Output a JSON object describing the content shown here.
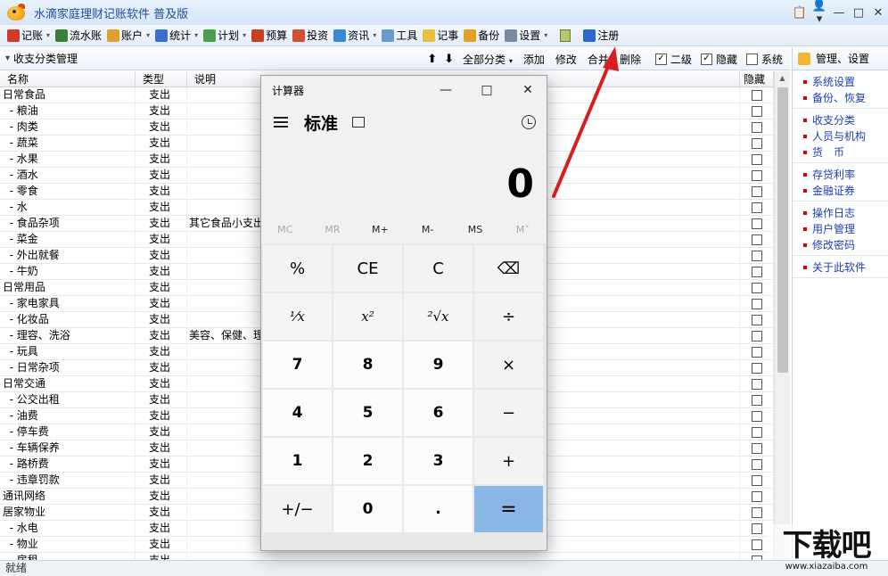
{
  "window": {
    "title": "水滴家庭理财记账软件  普及版",
    "controls": [
      "📋",
      "👤▾",
      "—",
      "□",
      "✕"
    ]
  },
  "menubar": {
    "items": [
      {
        "label": "记账",
        "has_arrow": true,
        "color": "#d23a2a"
      },
      {
        "label": "流水账",
        "has_arrow": false,
        "color": "#3c7f3c"
      },
      {
        "label": "账户",
        "has_arrow": true,
        "color": "#e0a030"
      },
      {
        "label": "统计",
        "has_arrow": true,
        "color": "#3a6fd0"
      },
      {
        "label": "计划",
        "has_arrow": true,
        "color": "#4aa04a"
      },
      {
        "label": "预算",
        "has_arrow": false,
        "color": "#c94020"
      },
      {
        "label": "投资",
        "has_arrow": false,
        "color": "#d05030"
      },
      {
        "label": "资讯",
        "has_arrow": true,
        "color": "#3a8ad0"
      },
      {
        "label": "工具",
        "has_arrow": false,
        "color": "#6a9ad0"
      },
      {
        "label": "记事",
        "has_arrow": false,
        "color": "#e8c040"
      },
      {
        "label": "备份",
        "has_arrow": false,
        "color": "#e0a020"
      },
      {
        "label": "设置",
        "has_arrow": true,
        "color": "#7a8aa0"
      },
      {
        "label": "注册",
        "has_arrow": false,
        "color": "#2a6ad0"
      }
    ]
  },
  "subbar": {
    "title": "收支分类管理",
    "filter": "全部分类",
    "actions": [
      "添加",
      "修改",
      "合并",
      "删除"
    ],
    "checks": [
      {
        "label": "二级",
        "checked": true
      },
      {
        "label": "隐藏",
        "checked": true
      },
      {
        "label": "系统",
        "checked": false
      }
    ]
  },
  "table": {
    "headers": {
      "name": "名称",
      "type": "类型",
      "desc": "说明",
      "hide": "隐藏"
    },
    "rows": [
      {
        "name": "日常食品",
        "type": "支出",
        "desc": ""
      },
      {
        "name": "  - 粮油",
        "type": "支出",
        "desc": ""
      },
      {
        "name": "  - 肉类",
        "type": "支出",
        "desc": ""
      },
      {
        "name": "  - 蔬菜",
        "type": "支出",
        "desc": ""
      },
      {
        "name": "  - 水果",
        "type": "支出",
        "desc": ""
      },
      {
        "name": "  - 酒水",
        "type": "支出",
        "desc": ""
      },
      {
        "name": "  - 零食",
        "type": "支出",
        "desc": ""
      },
      {
        "name": "  - 水",
        "type": "支出",
        "desc": ""
      },
      {
        "name": "  - 食品杂项",
        "type": "支出",
        "desc": "其它食品小支出"
      },
      {
        "name": "  - 菜金",
        "type": "支出",
        "desc": ""
      },
      {
        "name": "  - 外出就餐",
        "type": "支出",
        "desc": ""
      },
      {
        "name": "  - 牛奶",
        "type": "支出",
        "desc": ""
      },
      {
        "name": "日常用品",
        "type": "支出",
        "desc": ""
      },
      {
        "name": "  - 家电家具",
        "type": "支出",
        "desc": ""
      },
      {
        "name": "  - 化妆品",
        "type": "支出",
        "desc": ""
      },
      {
        "name": "  - 理容、洗浴",
        "type": "支出",
        "desc": "美容、保健、理"
      },
      {
        "name": "  - 玩具",
        "type": "支出",
        "desc": ""
      },
      {
        "name": "  - 日常杂项",
        "type": "支出",
        "desc": ""
      },
      {
        "name": "日常交通",
        "type": "支出",
        "desc": ""
      },
      {
        "name": "  - 公交出租",
        "type": "支出",
        "desc": ""
      },
      {
        "name": "  - 油费",
        "type": "支出",
        "desc": ""
      },
      {
        "name": "  - 停车费",
        "type": "支出",
        "desc": ""
      },
      {
        "name": "  - 车辆保养",
        "type": "支出",
        "desc": ""
      },
      {
        "name": "  - 路桥费",
        "type": "支出",
        "desc": ""
      },
      {
        "name": "  - 违章罚款",
        "type": "支出",
        "desc": ""
      },
      {
        "name": "通讯网络",
        "type": "支出",
        "desc": ""
      },
      {
        "name": "居家物业",
        "type": "支出",
        "desc": ""
      },
      {
        "name": "  - 水电",
        "type": "支出",
        "desc": ""
      },
      {
        "name": "  - 物业",
        "type": "支出",
        "desc": ""
      },
      {
        "name": "  - 房租",
        "type": "支出",
        "desc": ""
      }
    ]
  },
  "rightpanel": {
    "title": "管理、设置",
    "groups": [
      [
        "系统设置",
        "备份、恢复"
      ],
      [
        "收支分类",
        "人员与机构",
        "货　币"
      ],
      [
        "存贷利率",
        "金融证券"
      ],
      [
        "操作日志",
        "用户管理",
        "修改密码"
      ],
      [
        "关于此软件"
      ]
    ]
  },
  "status": "就绪",
  "calculator": {
    "title": "计算器",
    "mode": "标准",
    "display": "0",
    "memory": [
      {
        "label": "MC",
        "enabled": false
      },
      {
        "label": "MR",
        "enabled": false
      },
      {
        "label": "M+",
        "enabled": true
      },
      {
        "label": "M-",
        "enabled": true
      },
      {
        "label": "MS",
        "enabled": true
      },
      {
        "label": "M˅",
        "enabled": false
      }
    ],
    "keys": [
      {
        "label": "%",
        "kind": "op",
        "name": "percent-key"
      },
      {
        "label": "CE",
        "kind": "op",
        "name": "clear-entry-key"
      },
      {
        "label": "C",
        "kind": "op",
        "name": "clear-key"
      },
      {
        "label": "⌫",
        "kind": "op",
        "name": "backspace-key"
      },
      {
        "label": "¹⁄x",
        "kind": "func",
        "name": "reciprocal-key"
      },
      {
        "label": "x²",
        "kind": "func",
        "name": "square-key"
      },
      {
        "label": "²√x",
        "kind": "func",
        "name": "sqrt-key"
      },
      {
        "label": "÷",
        "kind": "op",
        "name": "divide-key"
      },
      {
        "label": "7",
        "kind": "num",
        "name": "digit-7-key"
      },
      {
        "label": "8",
        "kind": "num",
        "name": "digit-8-key"
      },
      {
        "label": "9",
        "kind": "num",
        "name": "digit-9-key"
      },
      {
        "label": "×",
        "kind": "op",
        "name": "multiply-key"
      },
      {
        "label": "4",
        "kind": "num",
        "name": "digit-4-key"
      },
      {
        "label": "5",
        "kind": "num",
        "name": "digit-5-key"
      },
      {
        "label": "6",
        "kind": "num",
        "name": "digit-6-key"
      },
      {
        "label": "−",
        "kind": "op",
        "name": "subtract-key"
      },
      {
        "label": "1",
        "kind": "num",
        "name": "digit-1-key"
      },
      {
        "label": "2",
        "kind": "num",
        "name": "digit-2-key"
      },
      {
        "label": "3",
        "kind": "num",
        "name": "digit-3-key"
      },
      {
        "label": "+",
        "kind": "op",
        "name": "add-key"
      },
      {
        "label": "+/−",
        "kind": "op",
        "name": "negate-key"
      },
      {
        "label": "0",
        "kind": "num",
        "name": "digit-0-key"
      },
      {
        "label": ".",
        "kind": "num",
        "name": "decimal-key"
      },
      {
        "label": "=",
        "kind": "eq",
        "name": "equals-key"
      }
    ],
    "window_controls": [
      "—",
      "□",
      "✕"
    ]
  },
  "watermark": {
    "main": "下载吧",
    "sub": "www.xiazaiba.com"
  },
  "colors": {
    "annotation_arrow": "#d81e1e",
    "equals_key": "#8bb7e6",
    "link": "#1a3fb5"
  }
}
